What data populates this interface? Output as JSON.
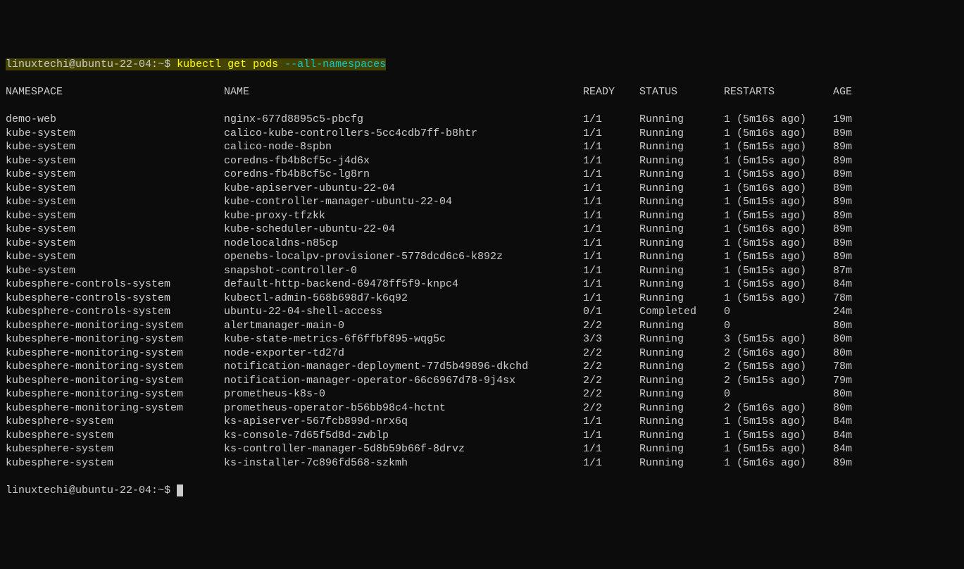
{
  "prompt": {
    "user_host": "linuxtechi@ubuntu-22-04",
    "path": "~",
    "symbol": "$",
    "command": "kubectl get pods",
    "flag": "--all-namespaces"
  },
  "headers": {
    "namespace": "NAMESPACE",
    "name": "NAME",
    "ready": "READY",
    "status": "STATUS",
    "restarts": "RESTARTS",
    "age": "AGE"
  },
  "rows": [
    {
      "ns": "demo-web",
      "name": "nginx-677d8895c5-pbcfg",
      "ready": "1/1",
      "status": "Running",
      "restarts": "1 (5m16s ago)",
      "age": "19m"
    },
    {
      "ns": "kube-system",
      "name": "calico-kube-controllers-5cc4cdb7ff-b8htr",
      "ready": "1/1",
      "status": "Running",
      "restarts": "1 (5m16s ago)",
      "age": "89m"
    },
    {
      "ns": "kube-system",
      "name": "calico-node-8spbn",
      "ready": "1/1",
      "status": "Running",
      "restarts": "1 (5m15s ago)",
      "age": "89m"
    },
    {
      "ns": "kube-system",
      "name": "coredns-fb4b8cf5c-j4d6x",
      "ready": "1/1",
      "status": "Running",
      "restarts": "1 (5m15s ago)",
      "age": "89m"
    },
    {
      "ns": "kube-system",
      "name": "coredns-fb4b8cf5c-lg8rn",
      "ready": "1/1",
      "status": "Running",
      "restarts": "1 (5m15s ago)",
      "age": "89m"
    },
    {
      "ns": "kube-system",
      "name": "kube-apiserver-ubuntu-22-04",
      "ready": "1/1",
      "status": "Running",
      "restarts": "1 (5m16s ago)",
      "age": "89m"
    },
    {
      "ns": "kube-system",
      "name": "kube-controller-manager-ubuntu-22-04",
      "ready": "1/1",
      "status": "Running",
      "restarts": "1 (5m15s ago)",
      "age": "89m"
    },
    {
      "ns": "kube-system",
      "name": "kube-proxy-tfzkk",
      "ready": "1/1",
      "status": "Running",
      "restarts": "1 (5m15s ago)",
      "age": "89m"
    },
    {
      "ns": "kube-system",
      "name": "kube-scheduler-ubuntu-22-04",
      "ready": "1/1",
      "status": "Running",
      "restarts": "1 (5m16s ago)",
      "age": "89m"
    },
    {
      "ns": "kube-system",
      "name": "nodelocaldns-n85cp",
      "ready": "1/1",
      "status": "Running",
      "restarts": "1 (5m15s ago)",
      "age": "89m"
    },
    {
      "ns": "kube-system",
      "name": "openebs-localpv-provisioner-5778dcd6c6-k892z",
      "ready": "1/1",
      "status": "Running",
      "restarts": "1 (5m15s ago)",
      "age": "89m"
    },
    {
      "ns": "kube-system",
      "name": "snapshot-controller-0",
      "ready": "1/1",
      "status": "Running",
      "restarts": "1 (5m15s ago)",
      "age": "87m"
    },
    {
      "ns": "kubesphere-controls-system",
      "name": "default-http-backend-69478ff5f9-knpc4",
      "ready": "1/1",
      "status": "Running",
      "restarts": "1 (5m15s ago)",
      "age": "84m"
    },
    {
      "ns": "kubesphere-controls-system",
      "name": "kubectl-admin-568b698d7-k6q92",
      "ready": "1/1",
      "status": "Running",
      "restarts": "1 (5m15s ago)",
      "age": "78m"
    },
    {
      "ns": "kubesphere-controls-system",
      "name": "ubuntu-22-04-shell-access",
      "ready": "0/1",
      "status": "Completed",
      "restarts": "0",
      "age": "24m"
    },
    {
      "ns": "kubesphere-monitoring-system",
      "name": "alertmanager-main-0",
      "ready": "2/2",
      "status": "Running",
      "restarts": "0",
      "age": "80m"
    },
    {
      "ns": "kubesphere-monitoring-system",
      "name": "kube-state-metrics-6f6ffbf895-wqg5c",
      "ready": "3/3",
      "status": "Running",
      "restarts": "3 (5m15s ago)",
      "age": "80m"
    },
    {
      "ns": "kubesphere-monitoring-system",
      "name": "node-exporter-td27d",
      "ready": "2/2",
      "status": "Running",
      "restarts": "2 (5m16s ago)",
      "age": "80m"
    },
    {
      "ns": "kubesphere-monitoring-system",
      "name": "notification-manager-deployment-77d5b49896-dkchd",
      "ready": "2/2",
      "status": "Running",
      "restarts": "2 (5m15s ago)",
      "age": "78m"
    },
    {
      "ns": "kubesphere-monitoring-system",
      "name": "notification-manager-operator-66c6967d78-9j4sx",
      "ready": "2/2",
      "status": "Running",
      "restarts": "2 (5m15s ago)",
      "age": "79m"
    },
    {
      "ns": "kubesphere-monitoring-system",
      "name": "prometheus-k8s-0",
      "ready": "2/2",
      "status": "Running",
      "restarts": "0",
      "age": "80m"
    },
    {
      "ns": "kubesphere-monitoring-system",
      "name": "prometheus-operator-b56bb98c4-hctnt",
      "ready": "2/2",
      "status": "Running",
      "restarts": "2 (5m16s ago)",
      "age": "80m"
    },
    {
      "ns": "kubesphere-system",
      "name": "ks-apiserver-567fcb899d-nrx6q",
      "ready": "1/1",
      "status": "Running",
      "restarts": "1 (5m15s ago)",
      "age": "84m"
    },
    {
      "ns": "kubesphere-system",
      "name": "ks-console-7d65f5d8d-zwblp",
      "ready": "1/1",
      "status": "Running",
      "restarts": "1 (5m15s ago)",
      "age": "84m"
    },
    {
      "ns": "kubesphere-system",
      "name": "ks-controller-manager-5d8b59b66f-8drvz",
      "ready": "1/1",
      "status": "Running",
      "restarts": "1 (5m15s ago)",
      "age": "84m"
    },
    {
      "ns": "kubesphere-system",
      "name": "ks-installer-7c896fd568-szkmh",
      "ready": "1/1",
      "status": "Running",
      "restarts": "1 (5m16s ago)",
      "age": "89m"
    }
  ]
}
